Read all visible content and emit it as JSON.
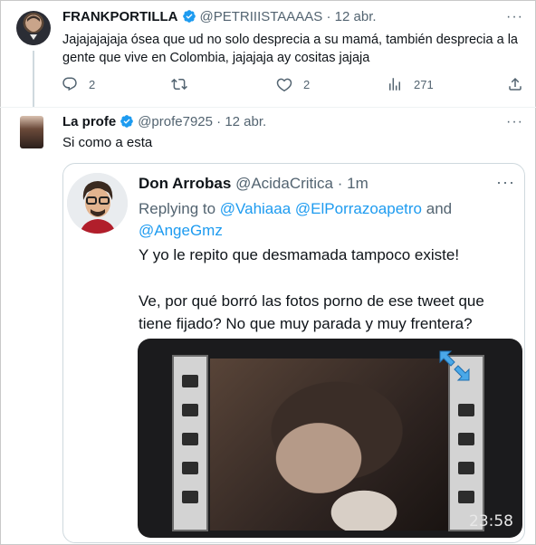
{
  "tweet1": {
    "author_name": "FRANKPORTILLA",
    "author_handle": "@PETRIIISTAAAAS",
    "date": "· 12 abr.",
    "text": "Jajajajajaja ósea que ud no solo  desprecia a su mamá, también desprecia a la gente que vive en Colombia, jajajaja ay cositas jajaja",
    "replies": "2",
    "likes": "2",
    "views": "271"
  },
  "tweet2": {
    "author_name": "La profe",
    "author_handle": "@profe7925",
    "date": "· 12 abr.",
    "text": "Si como a esta"
  },
  "embedded": {
    "author_name": "Don Arrobas",
    "author_handle": "@AcidaCritica",
    "time": "· 1m",
    "replying_prefix": "Replying to ",
    "mention1": "@Vahiaaa",
    "mention2": "@ElPorrazoapetro",
    "and_word": " and",
    "mention3": "@AngeGmz",
    "text1": "Y yo le repito que desmamada tampoco existe!",
    "text2": "Ve, por qué borró las fotos porno de ese tweet que tiene fijado? No que muy parada y muy frentera?",
    "video_duration": "23:58"
  },
  "icons": {
    "reply": "reply-icon",
    "retweet": "retweet-icon",
    "like": "heart-icon",
    "views": "views-icon",
    "share": "share-icon",
    "more": "more-icon",
    "verified": "verified-badge-icon"
  },
  "colors": {
    "accent": "#1d9bf0",
    "secondary_text": "#536471"
  }
}
